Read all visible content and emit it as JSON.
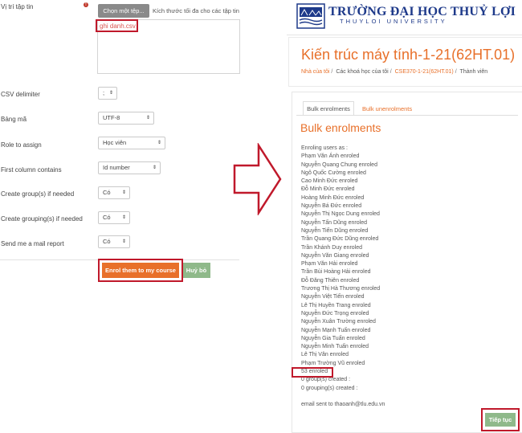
{
  "left": {
    "file_label": "Vị trí tập tin",
    "choose_button": "Chọn một tệp...",
    "max_size": "Kích thước tối đa cho các tập tin",
    "file_name": "ghi danh.csv",
    "csv_delimiter": {
      "label": "CSV delimiter",
      "value": ";"
    },
    "encoding": {
      "label": "Bảng mã",
      "value": "UTF-8"
    },
    "role": {
      "label": "Role to assign",
      "value": "Học viên"
    },
    "first_column": {
      "label": "First column contains",
      "value": "Id number"
    },
    "create_groups": {
      "label": "Create group(s) if needed",
      "value": "Có"
    },
    "create_groupings": {
      "label": "Create grouping(s) if needed",
      "value": "Có"
    },
    "send_report": {
      "label": "Send me a mail report",
      "value": "Có"
    },
    "enrol_button": "Enrol them to my course",
    "cancel_button": "Huỷ bỏ"
  },
  "right": {
    "university_name": "TRƯỜNG ĐẠI HỌC THUỶ LỢI",
    "university_sub": "THUYLOI UNIVERSITY",
    "course_title": "Kiến trúc máy tính-1-21(62HT.01)",
    "breadcrumb": [
      "Nhà của tôi",
      "Các khoá học của tôi",
      "CSE370-1-21(62HT.01)",
      "Thành viên"
    ],
    "tabs": {
      "active": "Bulk enrolments",
      "other": "Bulk unenrolments"
    },
    "heading": "Bulk enrolments",
    "log_lines": [
      "Enroling users as :",
      "Phạm Văn Ánh enroled",
      "Nguyễn Quang Chung enroled",
      "Ngô Quốc Cường enroled",
      "Cao Minh Đức enroled",
      "Đỗ Minh Đức enroled",
      "Hoàng Minh Đức enroled",
      "Nguyễn Bá Đức enroled",
      "Nguyễn Thị Ngọc Dung enroled",
      "Nguyễn Tấn Dũng enroled",
      "Nguyễn Tiến Dũng enroled",
      "Trần Quang Đức Dũng enroled",
      "Trần Khánh Duy enroled",
      "Nguyễn Văn Giang enroled",
      "Phạm Văn Hải enroled",
      "Trần Bùi Hoàng Hải enroled",
      "Đỗ Đăng Thiên enroled",
      "Trương Thị Hà Thương enroled",
      "Nguyễn Việt Tiến enroled",
      "Lê Thị Huyền Trang enroled",
      "Nguyễn Đức Trọng enroled",
      "Nguyễn Xuân Trường enroled",
      "Nguyễn Mạnh Tuấn enroled",
      "Nguyễn Gia Tuấn enroled",
      "Nguyễn Minh Tuấn enroled",
      "Lê Thị Vân enroled",
      "Phạm Trường Vũ enroled"
    ],
    "summary": "53 enroled",
    "groups_created": "0 group(s) created :",
    "groupings_created": "0 grouping(s) created :",
    "email_sent": "email sent to thaoanh@tlu.edu.vn",
    "next_button": "Tiếp tục"
  },
  "colors": {
    "accent": "#e8702a",
    "highlight": "#c0192b",
    "brand": "#1e3a8a",
    "success": "#8fb98a"
  }
}
